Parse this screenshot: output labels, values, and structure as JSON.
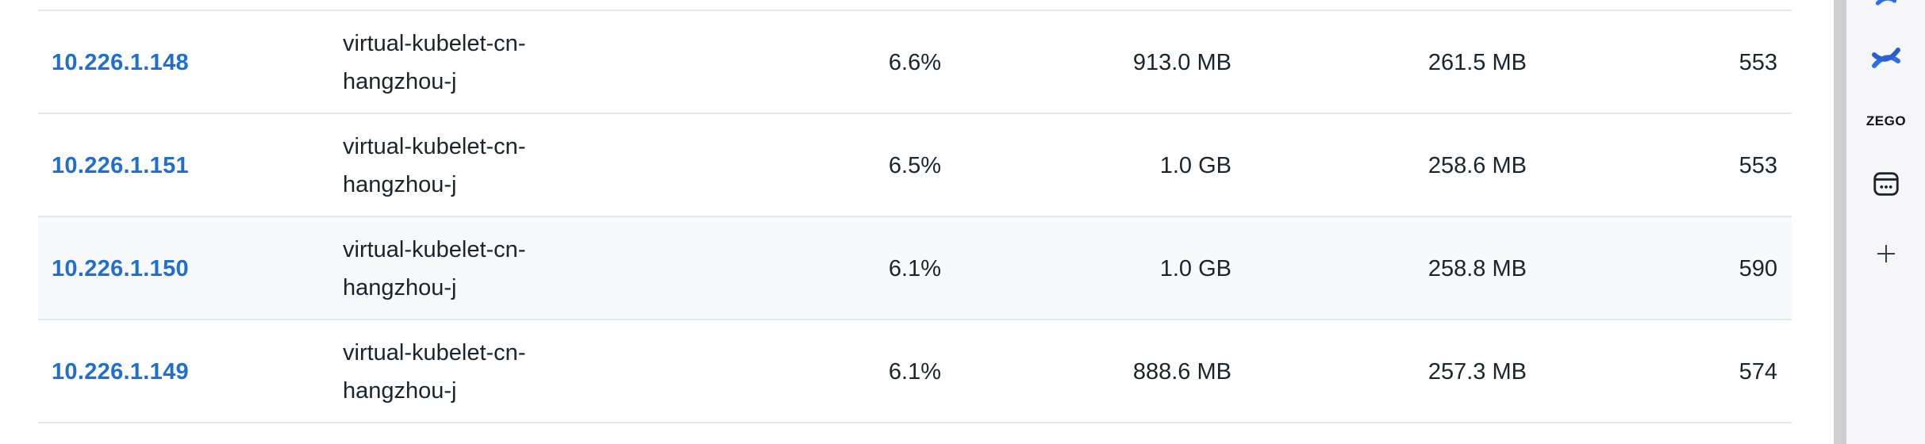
{
  "rows": [
    {
      "ip": "10.226.1.148",
      "node": "virtual-kubelet-cn-\nhangzhou-j",
      "cpu": "6.6%",
      "memory": "913.0 MB",
      "rss": "261.5 MB",
      "count": "553"
    },
    {
      "ip": "10.226.1.151",
      "node": "virtual-kubelet-cn-\nhangzhou-j",
      "cpu": "6.5%",
      "memory": "1.0 GB",
      "rss": "258.6 MB",
      "count": "553"
    },
    {
      "ip": "10.226.1.150",
      "node": "virtual-kubelet-cn-\nhangzhou-j",
      "cpu": "6.1%",
      "memory": "1.0 GB",
      "rss": "258.8 MB",
      "count": "590"
    },
    {
      "ip": "10.226.1.149",
      "node": "virtual-kubelet-cn-\nhangzhou-j",
      "cpu": "6.1%",
      "memory": "888.6 MB",
      "rss": "257.3 MB",
      "count": "574"
    }
  ],
  "sidebar": {
    "icons": [
      "confluence-icon",
      "zego-logo",
      "calendar-chat-icon",
      "plus-icon"
    ],
    "zego_text": "ZEGO"
  },
  "colors": {
    "link": "#1f6fd1",
    "highlight_row": "#f7f9fb",
    "border": "#e3e6ea"
  }
}
